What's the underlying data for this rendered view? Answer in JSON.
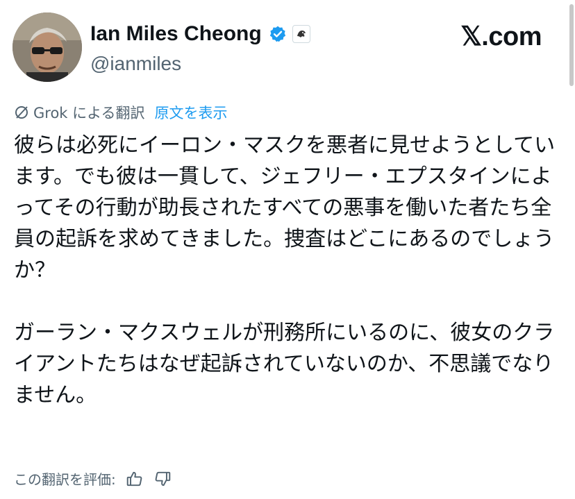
{
  "author": {
    "display_name": "Ian Miles Cheong",
    "handle": "@ianmiles",
    "verified_icon": "verified-badge-icon",
    "affiliation_icon": "affiliate-badge-icon"
  },
  "site_label": "𝕏.com",
  "translation": {
    "label": "Grok による翻訳",
    "original_link": "原文を表示"
  },
  "post": {
    "paragraphs": [
      "彼らは必死にイーロン・マスクを悪者に見せようとしています。でも彼は一貫して、ジェフリー・エプスタインによってその行動が助長されたすべての悪事を働いた者たち全員の起訴を求めてきました。捜査はどこにあるのでしょうか？",
      "ガーラン・マクスウェルが刑務所にいるのに、彼女のクライアントたちはなぜ起訴されていないのか、不思議でなりません。"
    ]
  },
  "rating": {
    "label": "この翻訳を評価:"
  },
  "colors": {
    "accent": "#1d9bf0",
    "secondary_text": "#536471",
    "primary_text": "#0f1419"
  }
}
